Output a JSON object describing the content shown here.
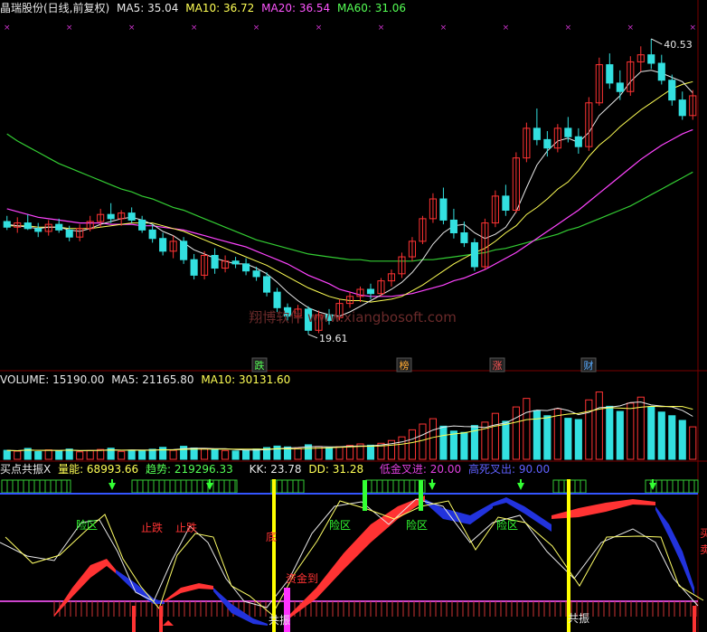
{
  "colors": {
    "bg": "#000000",
    "up": "#ff3333",
    "down": "#33e0e0",
    "ma5": "#e8e8e8",
    "ma10": "#ffff55",
    "ma20": "#ff44ff",
    "ma60": "#33cc33",
    "axis": "#7a0000"
  },
  "header_price": {
    "name": "晶瑞股份(日线,前复权)",
    "ma5": "MA5: 35.04",
    "ma10": "MA10: 36.72",
    "ma20": "MA20: 36.54",
    "ma60": "MA60: 31.06"
  },
  "header_volume": {
    "label": "VOLUME: 15190.00",
    "ma5": "MA5: 21165.80",
    "ma10": "MA10: 30131.60"
  },
  "header_ind": {
    "name": "买点共振X",
    "liang": "量能: 68993.66",
    "qushi": "趋势: 219296.33",
    "kk": "KK: 23.78",
    "dd": "DD: 31.28",
    "low": "低金叉进: 20.00",
    "high": "高死叉出: 90.00"
  },
  "watermark": "翔博软件 www.xiangbosoft.com",
  "price_annotations": {
    "high": "40.53",
    "low": "19.61"
  },
  "event_labels": [
    {
      "text": "跌",
      "color": "#55ff55"
    },
    {
      "text": "榜",
      "color": "#ffaa33"
    },
    {
      "text": "涨",
      "color": "#ff5555"
    },
    {
      "text": "财",
      "color": "#55aaff"
    }
  ],
  "ind_labels": {
    "risk": "险区",
    "stop": "止跌",
    "bottom": "底",
    "money": "资金到",
    "resonance": "共振",
    "buy": "买",
    "sell": "卖"
  },
  "chart_data": {
    "type": "candlestick",
    "title": "晶瑞股份(日线,前复权)",
    "price_range": [
      18,
      42
    ],
    "ohlc": [
      [
        27.6,
        28,
        27,
        27.2
      ],
      [
        27.2,
        27.9,
        26.8,
        27.5
      ],
      [
        27.5,
        28.1,
        27,
        27.1
      ],
      [
        27.1,
        27.5,
        26.5,
        26.9
      ],
      [
        26.9,
        27.7,
        26.6,
        27.4
      ],
      [
        27.4,
        27.8,
        26.8,
        27
      ],
      [
        27,
        27.3,
        26.2,
        26.5
      ],
      [
        26.5,
        27.4,
        26.2,
        27.1
      ],
      [
        27.1,
        28,
        26.9,
        27.6
      ],
      [
        27.6,
        28.5,
        27.2,
        28.1
      ],
      [
        28.1,
        28.9,
        27.5,
        27.8
      ],
      [
        27.8,
        28.4,
        27.3,
        28.2
      ],
      [
        28.2,
        28.6,
        27.5,
        27.7
      ],
      [
        27.7,
        28,
        26.8,
        27
      ],
      [
        27,
        27.4,
        26.1,
        26.4
      ],
      [
        26.4,
        26.8,
        25.2,
        25.5
      ],
      [
        25.5,
        26.6,
        25,
        26.2
      ],
      [
        26.2,
        26.5,
        24.6,
        24.9
      ],
      [
        24.9,
        25.3,
        23.5,
        23.8
      ],
      [
        23.8,
        25.5,
        23.5,
        25.2
      ],
      [
        25.2,
        25.7,
        23.9,
        24.3
      ],
      [
        24.3,
        25.2,
        24,
        24.8
      ],
      [
        24.8,
        25.1,
        24.3,
        24.6
      ],
      [
        24.6,
        25,
        23.8,
        24.1
      ],
      [
        24.1,
        24.4,
        23.4,
        23.7
      ],
      [
        23.7,
        24,
        22.3,
        22.6
      ],
      [
        22.6,
        22.9,
        21.2,
        21.5
      ],
      [
        21.5,
        21.8,
        20.6,
        20.9
      ],
      [
        20.9,
        21.7,
        20.4,
        21.4
      ],
      [
        21.4,
        21.6,
        19.61,
        19.9
      ],
      [
        19.9,
        21.3,
        19.7,
        21
      ],
      [
        21,
        21.4,
        20.3,
        20.6
      ],
      [
        20.8,
        22.1,
        20.6,
        21.8
      ],
      [
        21.8,
        22.6,
        21.5,
        22.3
      ],
      [
        22.3,
        23,
        21.9,
        22.8
      ],
      [
        22.8,
        23.2,
        22.1,
        22.5
      ],
      [
        22.5,
        23.6,
        22.3,
        23.4
      ],
      [
        23.4,
        24.2,
        23,
        23.9
      ],
      [
        23.9,
        25.4,
        23.6,
        25.1
      ],
      [
        25.1,
        26.5,
        24.8,
        26.2
      ],
      [
        26.2,
        28,
        26,
        27.8
      ],
      [
        27.8,
        29.6,
        27.5,
        29.2
      ],
      [
        29.2,
        30,
        27.4,
        27.7
      ],
      [
        27.7,
        28.5,
        26.4,
        26.8
      ],
      [
        26.8,
        27.6,
        25.8,
        26.1
      ],
      [
        26.1,
        26.4,
        24.1,
        24.4
      ],
      [
        24.4,
        27.8,
        24.2,
        27.5
      ],
      [
        27.5,
        29.8,
        27.2,
        29.4
      ],
      [
        29.4,
        30.2,
        28,
        28.4
      ],
      [
        28.4,
        32.5,
        28.2,
        32.1
      ],
      [
        32.1,
        34.6,
        31.8,
        34.2
      ],
      [
        34.2,
        35.6,
        33,
        33.4
      ],
      [
        33.4,
        34,
        32.2,
        32.8
      ],
      [
        32.8,
        34.5,
        32.5,
        34.2
      ],
      [
        34.2,
        35,
        33.2,
        33.6
      ],
      [
        33.6,
        34.2,
        32.4,
        32.9
      ],
      [
        32.9,
        36.4,
        32.6,
        36
      ],
      [
        36,
        39.2,
        35.8,
        38.7
      ],
      [
        38.7,
        39.5,
        37,
        37.4
      ],
      [
        37.4,
        38.3,
        36.2,
        36.8
      ],
      [
        36.8,
        39.3,
        36.5,
        38.9
      ],
      [
        38.9,
        40,
        38.2,
        39.4
      ],
      [
        39.4,
        40.53,
        38.4,
        38.8
      ],
      [
        38.8,
        39.4,
        37.3,
        37.6
      ],
      [
        37.6,
        38,
        35.8,
        36.2
      ],
      [
        36.2,
        36.8,
        34.8,
        35.1
      ],
      [
        35.1,
        36.9,
        34.8,
        36.5
      ]
    ],
    "ma5": [
      27.4,
      27.3,
      27.2,
      27.1,
      27.2,
      27.2,
      27,
      26.9,
      27.1,
      27.4,
      27.6,
      27.8,
      27.9,
      27.7,
      27.4,
      26.9,
      26.6,
      26.1,
      25.6,
      25.3,
      25,
      24.8,
      24.6,
      24.6,
      24.3,
      23.9,
      23.3,
      22.6,
      22,
      21.5,
      21.2,
      21,
      20.9,
      21.2,
      21.6,
      22,
      22.4,
      22.8,
      23.3,
      24,
      24.9,
      26,
      26.8,
      27.3,
      27.4,
      26.8,
      26.4,
      26.7,
      27.2,
      28.3,
      30,
      31.6,
      32.6,
      33.3,
      33.5,
      33.2,
      33.9,
      35.1,
      35.8,
      36.5,
      37.5,
      38.2,
      38.3,
      38.1,
      37.8,
      37.5,
      36.7
    ],
    "ma10": [
      27.3,
      27.3,
      27.3,
      27.2,
      27.2,
      27.2,
      27.1,
      27.1,
      27.1,
      27.2,
      27.3,
      27.4,
      27.5,
      27.5,
      27.5,
      27.3,
      27.1,
      26.9,
      26.6,
      26.3,
      26,
      25.7,
      25.4,
      25.1,
      24.8,
      24.5,
      24.1,
      23.7,
      23.3,
      22.9,
      22.6,
      22.3,
      22.1,
      22,
      22,
      21.9,
      22,
      22.1,
      22.3,
      22.7,
      23.1,
      23.6,
      24.1,
      24.6,
      25,
      25.4,
      25.7,
      26.2,
      26.8,
      27.3,
      28.1,
      28.6,
      29.2,
      29.9,
      30.4,
      31.2,
      32.2,
      33,
      33.6,
      34.3,
      34.9,
      35.5,
      36,
      36.5,
      37,
      37.3,
      37.5
    ],
    "ma20": [
      28.5,
      28.3,
      28.1,
      27.9,
      27.8,
      27.7,
      27.6,
      27.5,
      27.5,
      27.5,
      27.4,
      27.4,
      27.4,
      27.3,
      27.3,
      27.2,
      27.1,
      27,
      26.8,
      26.6,
      26.4,
      26.2,
      26,
      25.8,
      25.5,
      25.2,
      24.9,
      24.6,
      24.2,
      23.8,
      23.5,
      23.2,
      22.8,
      22.6,
      22.4,
      22.3,
      22.3,
      22.3,
      22.4,
      22.5,
      22.7,
      22.9,
      23.1,
      23.4,
      23.6,
      23.9,
      24.2,
      24.6,
      25,
      25.4,
      25.9,
      26.4,
      26.9,
      27.4,
      27.9,
      28.4,
      29,
      29.6,
      30.2,
      30.8,
      31.4,
      32,
      32.5,
      33,
      33.4,
      33.8,
      34.1
    ],
    "ma60": [
      33.8,
      33.3,
      32.9,
      32.5,
      32.1,
      31.7,
      31.4,
      31.1,
      30.8,
      30.5,
      30.2,
      29.9,
      29.7,
      29.4,
      29.2,
      28.9,
      28.6,
      28.4,
      28.1,
      27.8,
      27.5,
      27.2,
      26.9,
      26.6,
      26.3,
      26.1,
      25.9,
      25.7,
      25.5,
      25.3,
      25.2,
      25.1,
      25,
      24.9,
      24.9,
      24.8,
      24.8,
      24.8,
      24.8,
      24.8,
      24.9,
      24.9,
      25,
      25.1,
      25.2,
      25.3,
      25.4,
      25.6,
      25.7,
      25.9,
      26.1,
      26.3,
      26.5,
      26.7,
      27,
      27.2,
      27.5,
      27.8,
      28.1,
      28.4,
      28.7,
      29.1,
      29.5,
      29.9,
      30.3,
      30.7,
      31.1
    ],
    "volume": [
      4200,
      3800,
      5100,
      3600,
      4400,
      3900,
      4800,
      3500,
      4100,
      4600,
      5200,
      3700,
      4300,
      3900,
      4700,
      5600,
      4200,
      6100,
      5300,
      4900,
      4500,
      4100,
      3900,
      4200,
      4800,
      5500,
      6200,
      5800,
      5100,
      6800,
      6000,
      5400,
      5900,
      6500,
      7200,
      6600,
      7500,
      8800,
      10500,
      13800,
      16500,
      19000,
      15500,
      13200,
      12600,
      15800,
      17400,
      21500,
      17800,
      24500,
      28500,
      22800,
      20400,
      23600,
      19200,
      18600,
      27800,
      31500,
      24800,
      22400,
      26300,
      29100,
      24600,
      22100,
      20400,
      18200,
      15190
    ],
    "volume_range": [
      0,
      33000
    ],
    "xlabel": "",
    "ylabel": ""
  }
}
